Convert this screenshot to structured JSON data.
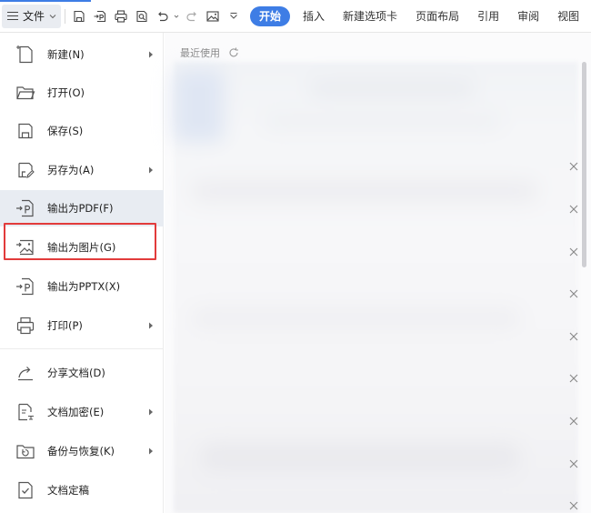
{
  "toolbar": {
    "file_menu_label": "文件",
    "icons": [
      "hamburger-icon",
      "chevron-down-icon",
      "save-icon",
      "export-pdf-icon",
      "print-icon",
      "print-preview-icon",
      "undo-icon",
      "redo-icon",
      "picture-icon",
      "more-icon"
    ],
    "tabs": [
      {
        "label": "开始",
        "active": true
      },
      {
        "label": "插入",
        "active": false
      },
      {
        "label": "新建选项卡",
        "active": false
      },
      {
        "label": "页面布局",
        "active": false
      },
      {
        "label": "引用",
        "active": false
      },
      {
        "label": "审阅",
        "active": false
      },
      {
        "label": "视图",
        "active": false
      }
    ],
    "accent_color": "#3e7de5"
  },
  "file_menu": {
    "items": [
      {
        "label": "新建(N)",
        "icon": "new-document-icon",
        "has_submenu": true
      },
      {
        "label": "打开(O)",
        "icon": "folder-open-icon",
        "has_submenu": false
      },
      {
        "label": "保存(S)",
        "icon": "save-icon",
        "has_submenu": false
      },
      {
        "label": "另存为(A)",
        "icon": "save-as-icon",
        "has_submenu": true
      },
      {
        "label": "输出为PDF(F)",
        "icon": "export-pdf-icon",
        "has_submenu": false,
        "highlighted": true
      },
      {
        "label": "输出为图片(G)",
        "icon": "export-image-icon",
        "has_submenu": false
      },
      {
        "label": "输出为PPTX(X)",
        "icon": "export-pptx-icon",
        "has_submenu": false
      },
      {
        "label": "打印(P)",
        "icon": "print-icon",
        "has_submenu": true
      },
      {
        "label": "分享文档(D)",
        "icon": "share-icon",
        "has_submenu": false
      },
      {
        "label": "文档加密(E)",
        "icon": "encrypt-icon",
        "has_submenu": true
      },
      {
        "label": "备份与恢复(K)",
        "icon": "backup-icon",
        "has_submenu": true
      },
      {
        "label": "文档定稿",
        "icon": "finalize-icon",
        "has_submenu": false
      }
    ],
    "highlight_color": "#e23b3b"
  },
  "recent": {
    "header": "最近使用",
    "close_icon": "close-icon"
  }
}
